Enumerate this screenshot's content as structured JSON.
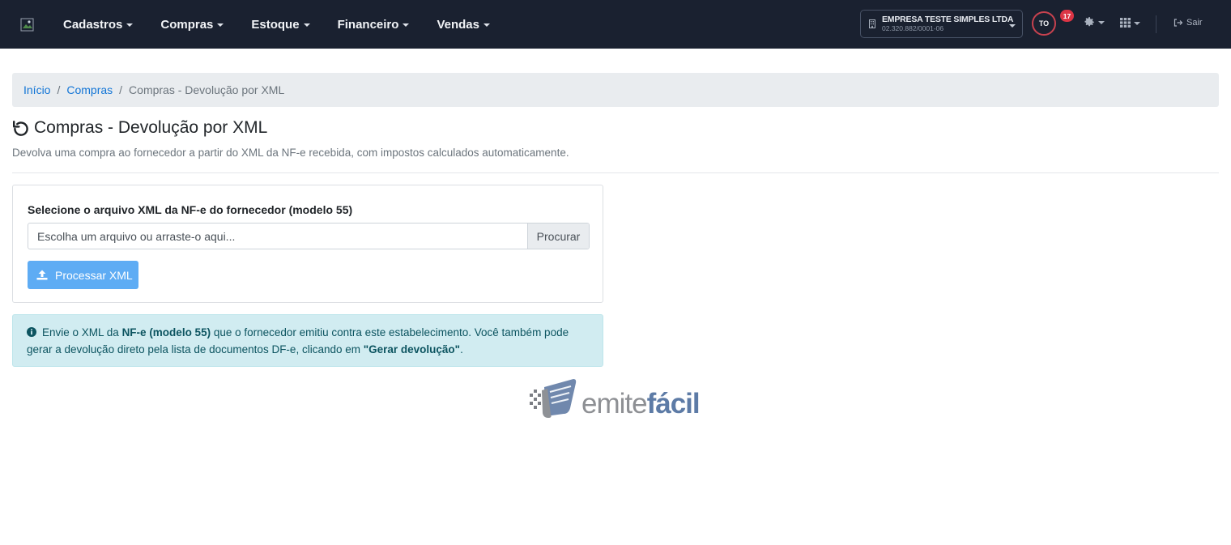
{
  "nav": {
    "menu": [
      {
        "label": "Cadastros"
      },
      {
        "label": "Compras"
      },
      {
        "label": "Estoque"
      },
      {
        "label": "Financeiro"
      },
      {
        "label": "Vendas"
      }
    ],
    "company": {
      "name": "EMPRESA TESTE SIMPLES LTDA",
      "cnpj": "02.320.882/0001-06"
    },
    "avatar_initials": "TO",
    "notification_count": "17",
    "logout_label": "Sair",
    "icons": {
      "company": "building-icon",
      "settings": "gear-icon",
      "apps": "grid-icon",
      "logout": "sign-out-icon"
    }
  },
  "breadcrumb": {
    "home": "Início",
    "section": "Compras",
    "separator": "/",
    "current": "Compras - Devolução por XML"
  },
  "page": {
    "title": "Compras - Devolução por XML",
    "subtitle": "Devolva uma compra ao fornecedor a partir do XML da NF-e recebida, com impostos calculados automaticamente.",
    "title_icon": "undo-icon"
  },
  "form": {
    "label": "Selecione o arquivo XML da NF-e do fornecedor (modelo 55)",
    "file_placeholder": "Escolha um arquivo ou arraste-o aqui...",
    "browse_label": "Procurar",
    "process_label": "Processar XML",
    "process_icon": "upload-icon"
  },
  "alert": {
    "part1": "Envie o XML da ",
    "bold1": "NF-e (modelo 55)",
    "part2": " que o fornecedor emitiu contra este estabelecimento. Você também pode gerar a devolução direto pela lista de documentos DF-e, clicando em ",
    "bold2": "\"Gerar devolução\"",
    "part3": ".",
    "icon": "info-circle-icon"
  },
  "logo": {
    "emite": "emite",
    "facil": "fácil"
  },
  "colors": {
    "navbar": "#1a2130",
    "link": "#1275d6",
    "primary_button": "#5eacf4",
    "alert_bg": "#d1ecf1",
    "alert_text": "#0c5460",
    "badge": "#dc3545"
  }
}
